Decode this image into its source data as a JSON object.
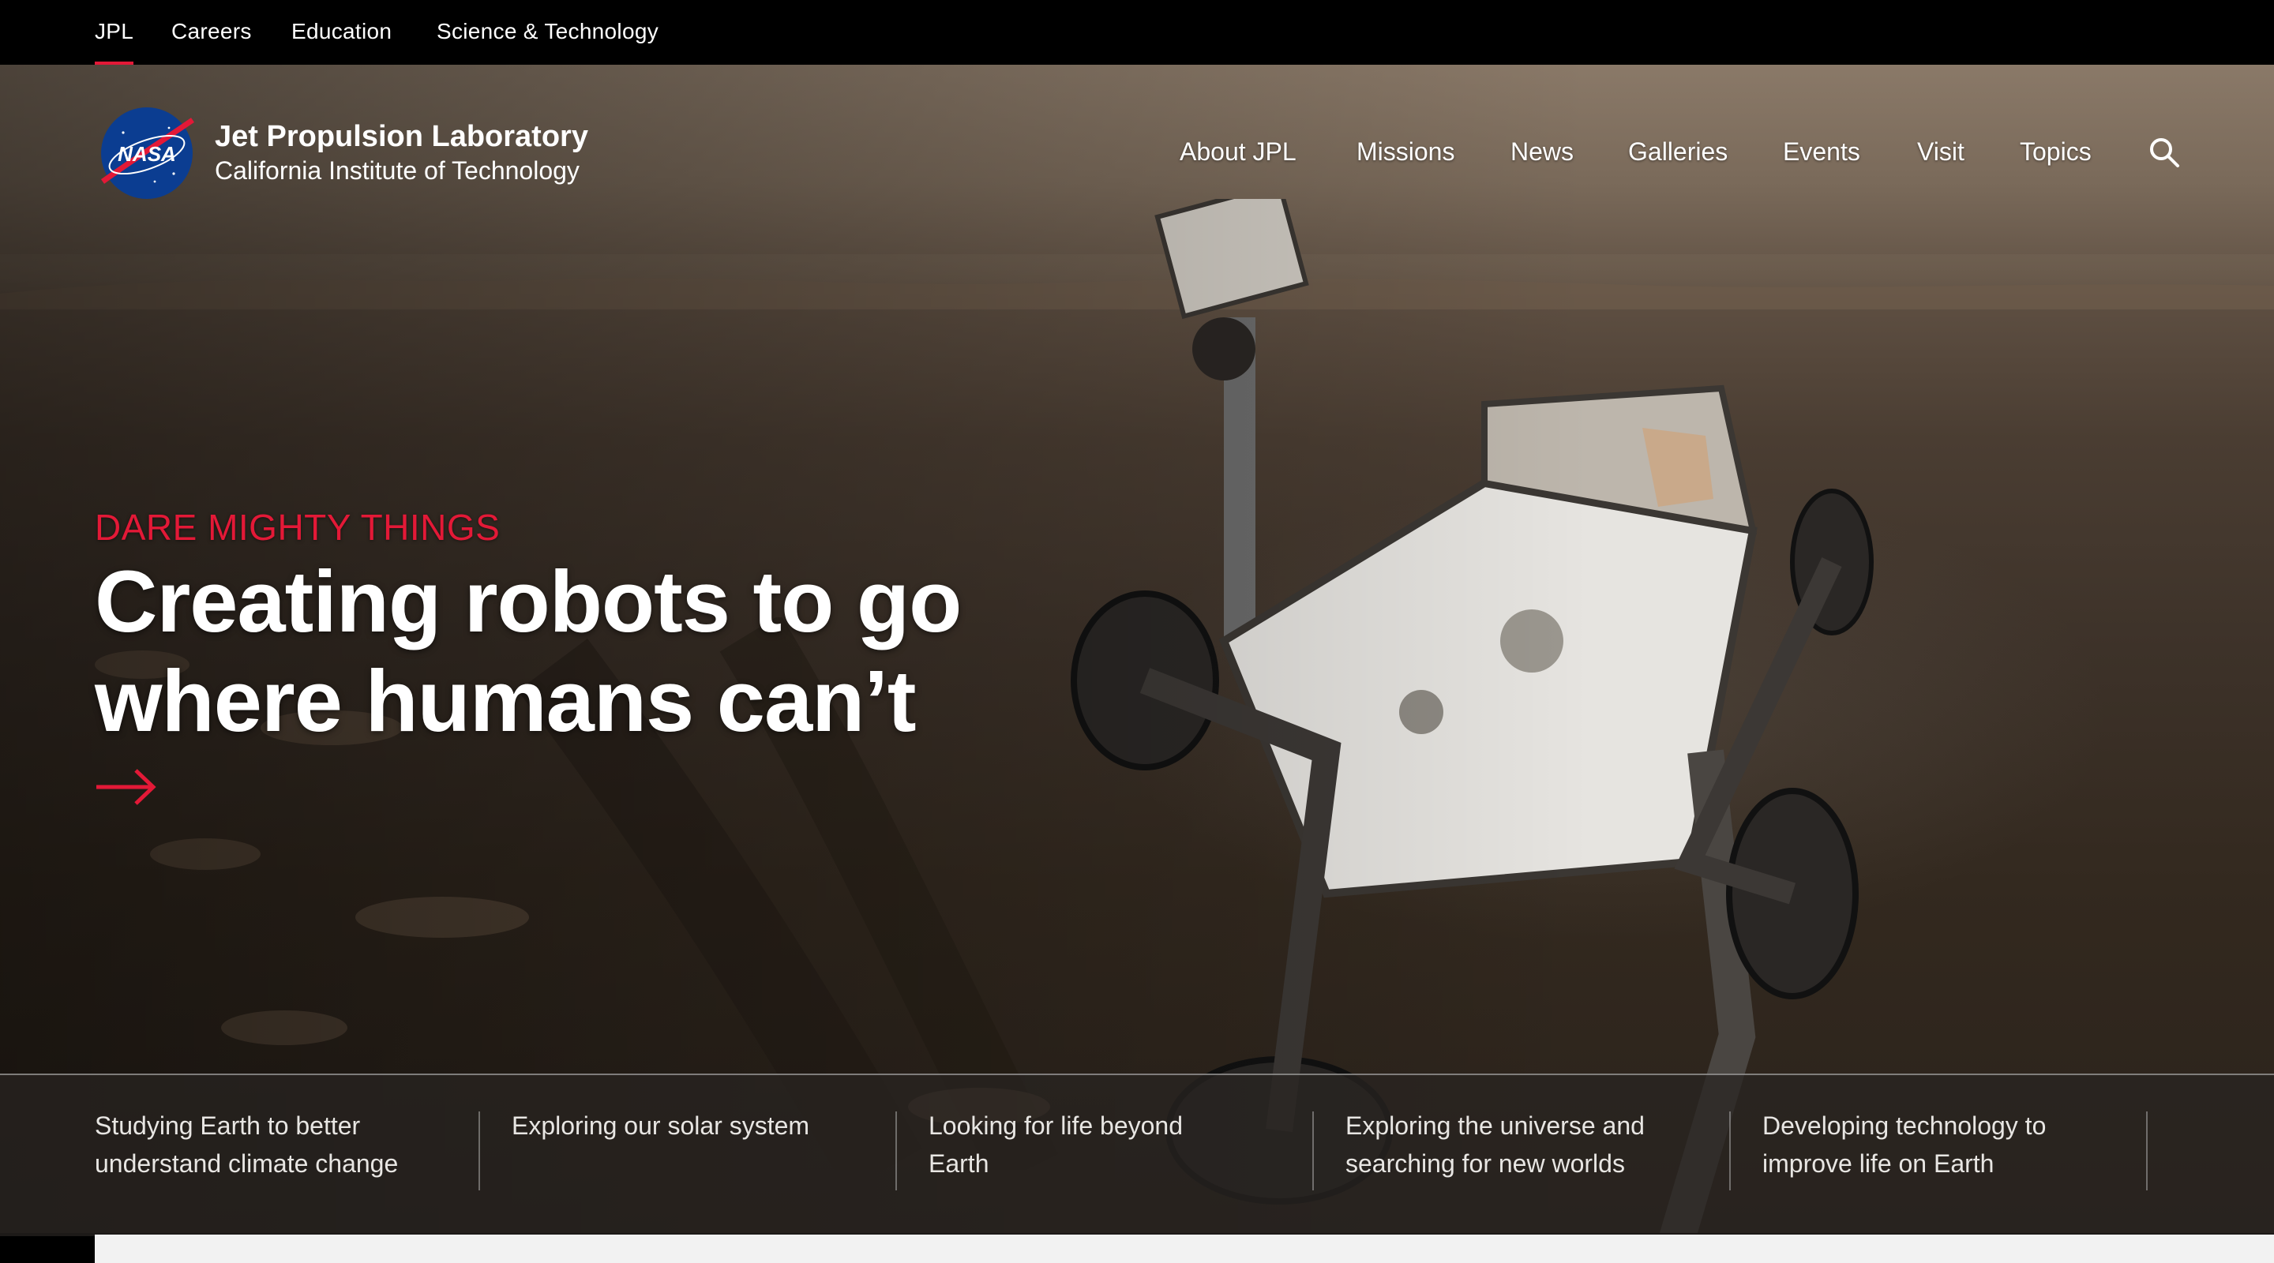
{
  "top_links": [
    {
      "label": "JPL",
      "active": true
    },
    {
      "label": "Careers",
      "active": false
    },
    {
      "label": "Education",
      "active": false
    },
    {
      "label": "Science & Technology",
      "active": false
    }
  ],
  "brand": {
    "logo_text": "NASA",
    "title": "Jet Propulsion Laboratory",
    "subtitle": "California Institute of Technology"
  },
  "nav": [
    {
      "label": "About JPL"
    },
    {
      "label": "Missions"
    },
    {
      "label": "News"
    },
    {
      "label": "Galleries"
    },
    {
      "label": "Events"
    },
    {
      "label": "Visit"
    },
    {
      "label": "Topics"
    }
  ],
  "search_icon": "search-icon",
  "hero": {
    "kicker": "DARE MIGHTY THINGS",
    "headline_line1": "Creating robots to go",
    "headline_line2": "where humans can’t",
    "arrow_icon": "arrow-right-icon"
  },
  "topics": [
    {
      "line1": "Studying Earth to better",
      "line2": "understand climate change"
    },
    {
      "line1": "Exploring our solar system",
      "line2": ""
    },
    {
      "line1": "Looking for life beyond",
      "line2": "Earth"
    },
    {
      "line1": "Exploring the universe and",
      "line2": "searching for new worlds"
    },
    {
      "line1": "Developing technology to",
      "line2": "improve life on Earth"
    }
  ],
  "colors": {
    "accent": "#e31937",
    "topbar_bg": "#000000",
    "strip_bg": "#28241f"
  }
}
